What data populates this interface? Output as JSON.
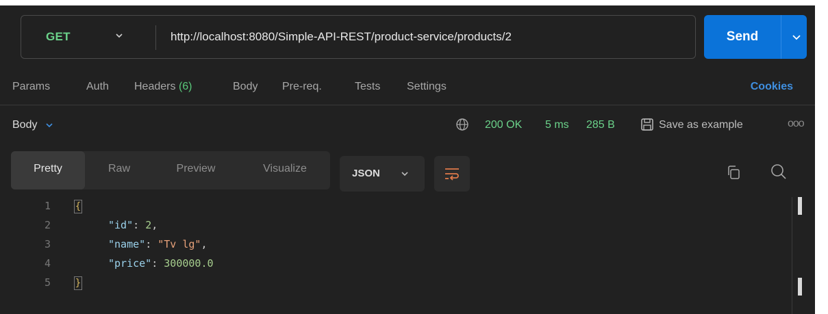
{
  "request": {
    "method": "GET",
    "url": "http://localhost:8080/Simple-API-REST/product-service/products/2",
    "send_label": "Send"
  },
  "request_tabs": {
    "params": "Params",
    "auth": "Auth",
    "headers": "Headers",
    "headers_count": "(6)",
    "body": "Body",
    "prereq": "Pre-req.",
    "tests": "Tests",
    "settings": "Settings",
    "cookies": "Cookies"
  },
  "response": {
    "body_label": "Body",
    "status": "200 OK",
    "time": "5 ms",
    "size": "285 B",
    "save_label": "Save as example",
    "more": "ooo"
  },
  "view_tabs": {
    "pretty": "Pretty",
    "raw": "Raw",
    "preview": "Preview",
    "visualize": "Visualize",
    "format": "JSON"
  },
  "code": {
    "line_numbers": [
      "1",
      "2",
      "3",
      "4",
      "5"
    ],
    "open_brace": "{",
    "close_brace": "}",
    "id_key": "\"id\"",
    "id_value": "2",
    "name_key": "\"name\"",
    "name_value": "\"Tv lg\"",
    "price_key": "\"price\"",
    "price_value": "300000.0",
    "colon": ": ",
    "comma": ","
  },
  "colors": {
    "background": "#212121",
    "accent": "#0b73d9",
    "status_ok": "#6bd28a",
    "json_key": "#9bd2ec",
    "json_string": "#e8a27a",
    "json_number": "#a7cf8e"
  }
}
